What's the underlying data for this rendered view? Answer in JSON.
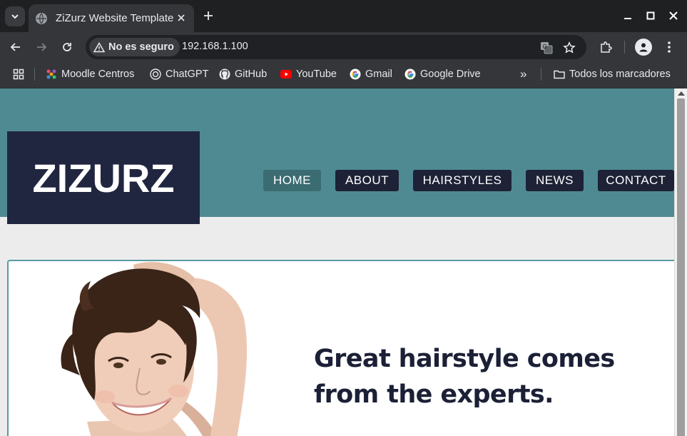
{
  "browser": {
    "tab_title": "ZiZurz Website Template",
    "security_label": "No es seguro",
    "url": "192.168.1.100",
    "bookmarks": [
      {
        "label": "Moodle Centros",
        "icon": "moodle-icon"
      },
      {
        "label": "ChatGPT",
        "icon": "chatgpt-icon"
      },
      {
        "label": "GitHub",
        "icon": "github-icon"
      },
      {
        "label": "YouTube",
        "icon": "youtube-icon"
      },
      {
        "label": "Gmail",
        "icon": "google-icon"
      },
      {
        "label": "Google Drive",
        "icon": "google-icon"
      }
    ],
    "overflow_label": "»",
    "all_bookmarks_label": "Todos los marcadores"
  },
  "site": {
    "logo": "ZIZURZ",
    "nav": [
      "HOME",
      "ABOUT",
      "HAIRSTYLES",
      "NEWS",
      "CONTACT"
    ],
    "active_nav": "HOME",
    "hero_line1": "Great hairstyle comes",
    "hero_line2": "from the experts."
  },
  "colors": {
    "header_bg": "#4f8a92",
    "logo_bg": "#212640",
    "nav_bg": "#1d2236",
    "nav_active_bg": "#3a6c72",
    "hero_text": "#1b2036",
    "page_bg": "#ececec"
  }
}
